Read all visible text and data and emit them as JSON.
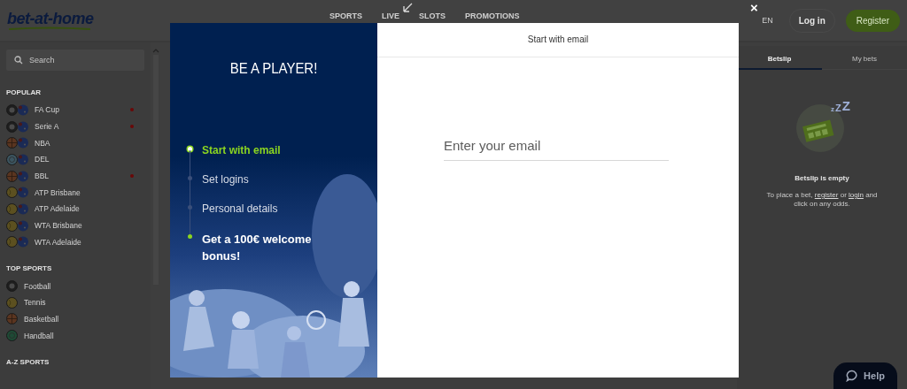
{
  "header": {
    "logo": "bet-at-home",
    "nav": [
      "SPORTS",
      "LIVE",
      "SLOTS",
      "PROMOTIONS"
    ],
    "language": "EN",
    "login": "Log in",
    "register": "Register"
  },
  "sidebar": {
    "search": {
      "placeholder": "Search"
    },
    "sections": [
      {
        "title": "POPULAR",
        "items": [
          {
            "label": "FA Cup",
            "kind": "football",
            "flagged": true,
            "live": true
          },
          {
            "label": "Serie A",
            "kind": "football",
            "flagged": true,
            "live": true
          },
          {
            "label": "NBA",
            "kind": "basketball",
            "flagged": true,
            "live": false
          },
          {
            "label": "DEL",
            "kind": "hockey",
            "flagged": true,
            "live": false
          },
          {
            "label": "BBL",
            "kind": "basketball",
            "flagged": true,
            "live": true
          },
          {
            "label": "ATP Brisbane",
            "kind": "tennis",
            "flagged": true,
            "live": false
          },
          {
            "label": "ATP Adelaide",
            "kind": "tennis",
            "flagged": true,
            "live": false
          },
          {
            "label": "WTA Brisbane",
            "kind": "tennis",
            "flagged": true,
            "live": false
          },
          {
            "label": "WTA Adelaide",
            "kind": "tennis",
            "flagged": true,
            "live": false
          }
        ]
      },
      {
        "title": "TOP SPORTS",
        "items": [
          {
            "label": "Football",
            "kind": "football",
            "flagged": false,
            "live": false
          },
          {
            "label": "Tennis",
            "kind": "tennis",
            "flagged": false,
            "live": false
          },
          {
            "label": "Basketball",
            "kind": "basketball",
            "flagged": false,
            "live": false
          },
          {
            "label": "Handball",
            "kind": "handball",
            "flagged": false,
            "live": false
          }
        ]
      },
      {
        "title": "A-Z SPORTS"
      }
    ]
  },
  "betslip": {
    "tabs": [
      {
        "label": "Betslip",
        "selected": true
      },
      {
        "label": "My bets",
        "selected": false
      }
    ],
    "sleep_marks": [
      "z",
      "Z",
      "Z"
    ],
    "empty_title": "Betslip is empty",
    "empty_text": [
      {
        "text": "To place a bet, ",
        "link": false
      },
      {
        "text": "register",
        "link": true
      },
      {
        "text": " or ",
        "link": false
      },
      {
        "text": "login",
        "link": true
      },
      {
        "text": " and click on any odds.",
        "link": false
      }
    ]
  },
  "help": "Help",
  "modal": {
    "close": "×",
    "title": "BE A PLAYER!",
    "steps": [
      {
        "label": "Start with email",
        "kind": "step",
        "selected": true
      },
      {
        "label": "Set logins",
        "kind": "step",
        "selected": false
      },
      {
        "label": "Personal details",
        "kind": "step",
        "selected": false
      },
      {
        "label": "Get a 100€ welcome bonus!",
        "kind": "bonus",
        "selected": false
      }
    ],
    "heading": "Start with email",
    "email": {
      "placeholder": "Enter your email"
    }
  }
}
